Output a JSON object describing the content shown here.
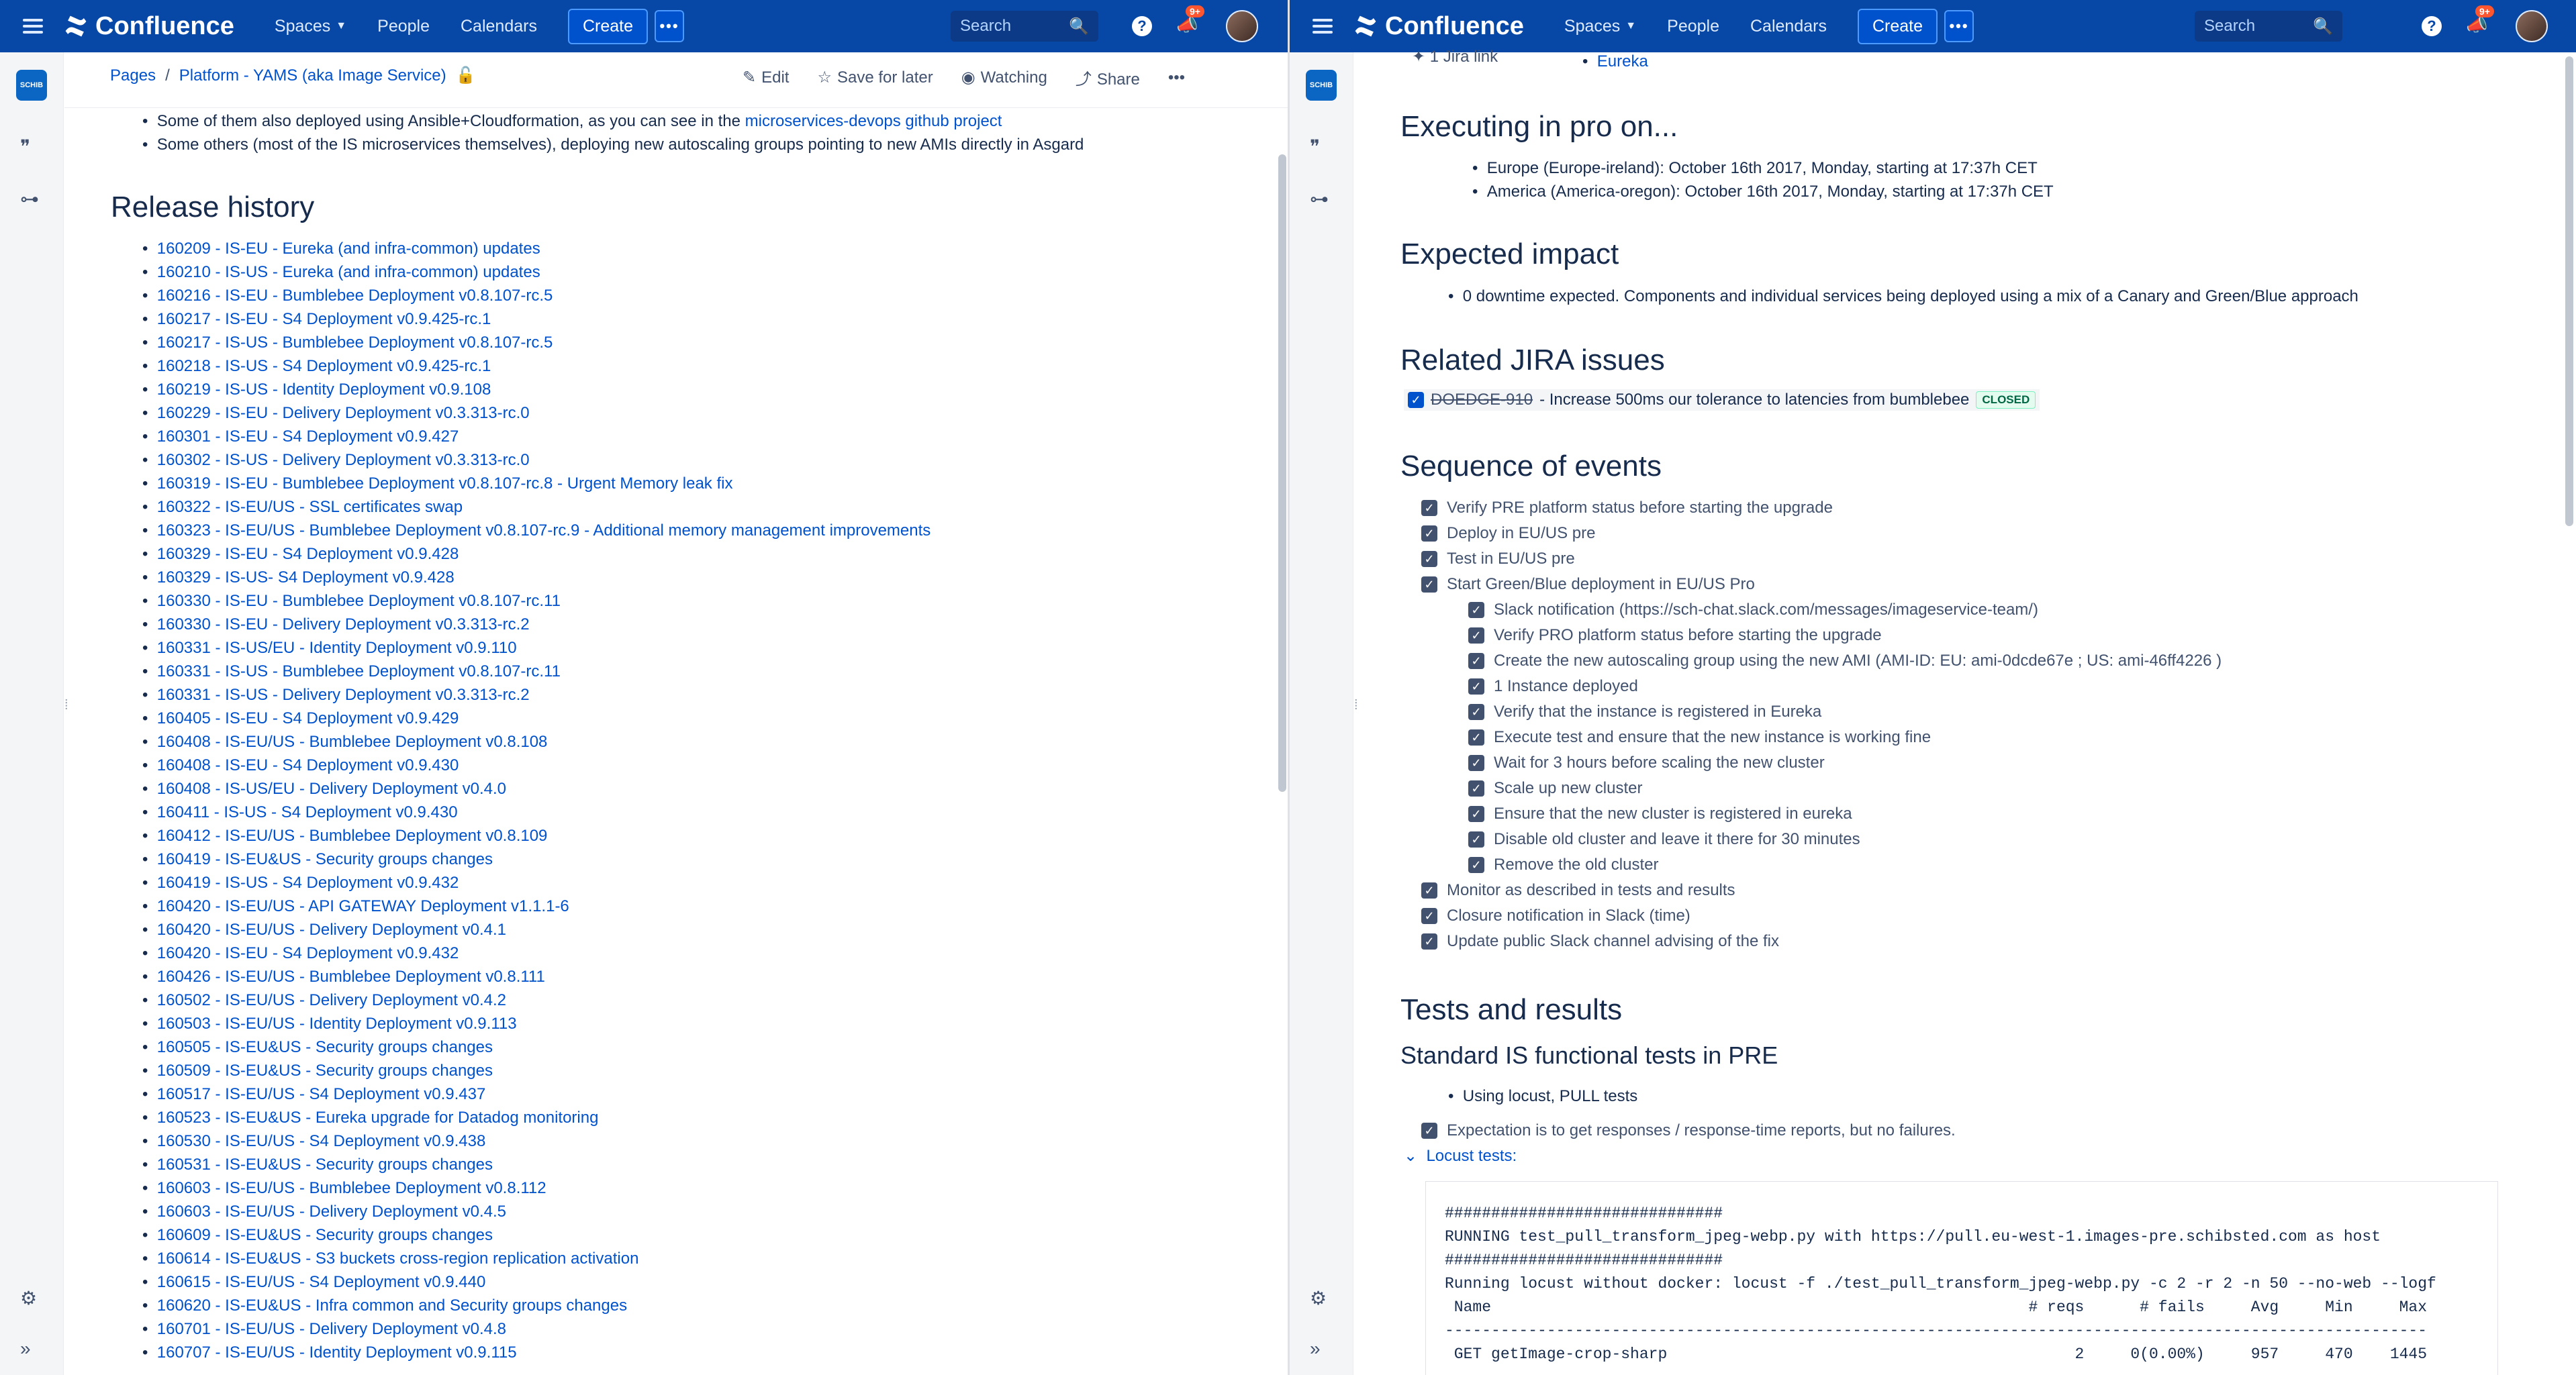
{
  "header": {
    "app_name": "Confluence",
    "nav": [
      "Spaces",
      "People",
      "Calendars"
    ],
    "create_label": "Create",
    "more_label": "•••",
    "search_placeholder": "Search",
    "notifications_badge": "9+",
    "help_label": "?"
  },
  "left": {
    "breadcrumb": [
      "Pages",
      "Platform - YAMS (aka Image Service)"
    ],
    "actions": {
      "edit": "Edit",
      "save_for_later": "Save for later",
      "watching": "Watching",
      "share": "Share",
      "more": "•••"
    },
    "intro_bullets": [
      {
        "text": "Some of them also deployed using Ansible+Cloudformation, as you can see in the ",
        "link": "microservices-devops github project"
      },
      {
        "text": "Some others (most of the IS microservices themselves), deploying new autoscaling groups pointing to new AMIs directly in Asgard",
        "link": ""
      }
    ],
    "release_heading": "Release history",
    "releases": [
      "160209 - IS-EU - Eureka (and infra-common) updates",
      "160210 - IS-US - Eureka (and infra-common) updates",
      "160216 - IS-EU - Bumblebee Deployment v0.8.107-rc.5",
      "160217 - IS-EU - S4 Deployment v0.9.425-rc.1",
      "160217 - IS-US - Bumblebee Deployment v0.8.107-rc.5",
      "160218 - IS-US - S4 Deployment v0.9.425-rc.1",
      "160219 - IS-US - Identity Deployment v0.9.108",
      "160229 - IS-EU - Delivery Deployment v0.3.313-rc.0",
      "160301 - IS-EU - S4 Deployment v0.9.427",
      "160302 - IS-US - Delivery Deployment v0.3.313-rc.0",
      "160319 - IS-EU - Bumblebee Deployment v0.8.107-rc.8 - Urgent Memory leak fix",
      "160322 - IS-EU/US - SSL certificates swap",
      "160323 - IS-EU/US - Bumblebee Deployment v0.8.107-rc.9 - Additional memory management improvements",
      "160329 - IS-EU - S4 Deployment v0.9.428",
      "160329 - IS-US- S4 Deployment v0.9.428",
      "160330 - IS-EU - Bumblebee Deployment v0.8.107-rc.11",
      "160330 - IS-EU - Delivery Deployment v0.3.313-rc.2",
      "160331 - IS-US/EU - Identity Deployment v0.9.110",
      "160331 - IS-US - Bumblebee Deployment v0.8.107-rc.11",
      "160331 - IS-US - Delivery Deployment v0.3.313-rc.2",
      "160405 - IS-EU - S4 Deployment v0.9.429",
      "160408 - IS-EU/US - Bumblebee Deployment v0.8.108",
      "160408 - IS-EU - S4 Deployment v0.9.430",
      "160408 - IS-US/EU - Delivery Deployment v0.4.0",
      "160411 - IS-US - S4 Deployment v0.9.430",
      "160412 - IS-EU/US - Bumblebee Deployment v0.8.109",
      "160419 - IS-EU&US - Security groups changes",
      "160419 - IS-US - S4 Deployment v0.9.432",
      "160420 - IS-EU/US - API GATEWAY Deployment v1.1.1-6",
      "160420 - IS-EU/US - Delivery Deployment v0.4.1",
      "160420 - IS-EU - S4 Deployment v0.9.432",
      "160426 - IS-EU/US - Bumblebee Deployment v0.8.111",
      "160502 - IS-EU/US - Delivery Deployment v0.4.2",
      "160503 - IS-EU/US - Identity Deployment v0.9.113",
      "160505 - IS-EU&US - Security groups changes",
      "160509 - IS-EU&US - Security groups changes",
      "160517 - IS-EU/US - S4 Deployment v0.9.437",
      "160523 - IS-EU&US - Eureka upgrade for Datadog monitoring",
      "160530 - IS-EU/US - S4 Deployment v0.9.438",
      "160531 - IS-EU&US - Security groups changes",
      "160603 - IS-EU/US - Bumblebee Deployment v0.8.112",
      "160603 - IS-EU/US - Delivery Deployment v0.4.5",
      "160609 - IS-EU&US - Security groups changes",
      "160614 - IS-EU&US - S3 buckets cross-region replication activation",
      "160615 - IS-EU/US - S4 Deployment v0.9.440",
      "160620 - IS-EU&US - Infra common and Security groups changes",
      "160701 - IS-EU/US - Delivery Deployment v0.4.8",
      "160707 - IS-EU/US - Identity Deployment v0.9.115"
    ]
  },
  "right": {
    "jira_link_label": "1 Jira link",
    "eureka_link": "Eureka",
    "executing_heading": "Executing in pro on...",
    "executing_items": [
      "Europe (Europe-ireland): October 16th 2017, Monday, starting at 17:37h CET",
      "America (America-oregon): October 16th 2017, Monday, starting at 17:37h CET"
    ],
    "impact_heading": "Expected impact",
    "impact_items": [
      "0 downtime expected. Components and individual services being deployed using a mix of a Canary and Green/Blue approach"
    ],
    "jira_heading": "Related JIRA issues",
    "jira_issue": {
      "key": "DOEDGE-910",
      "summary": " - Increase 500ms our tolerance to latencies from bumblebee",
      "status": "CLOSED"
    },
    "sequence_heading": "Sequence of events",
    "tasks": [
      {
        "text": "Verify PRE platform status before starting the upgrade",
        "level": 0
      },
      {
        "text": "Deploy in EU/US pre",
        "level": 0
      },
      {
        "text": "Test in EU/US pre",
        "level": 0
      },
      {
        "text": "Start Green/Blue deployment in EU/US Pro",
        "level": 0
      },
      {
        "text": "Slack notification (https://sch-chat.slack.com/messages/imageservice-team/)",
        "level": 1
      },
      {
        "text": "Verify PRO platform status before starting the upgrade",
        "level": 1
      },
      {
        "text": "Create the new autoscaling group using the new AMI (AMI-ID: EU: ami-0dcde67e ; US: ami-46ff4226 )",
        "level": 1
      },
      {
        "text": "1 Instance deployed",
        "level": 1
      },
      {
        "text": "Verify that the instance is registered in Eureka",
        "level": 1
      },
      {
        "text": "Execute test and ensure that the new instance is working fine",
        "level": 1
      },
      {
        "text": "Wait for 3 hours before scaling the new cluster",
        "level": 1
      },
      {
        "text": "Scale up new cluster",
        "level": 1
      },
      {
        "text": "Ensure that the new cluster is registered in eureka",
        "level": 1
      },
      {
        "text": "Disable old cluster and leave it there for 30 minutes",
        "level": 1
      },
      {
        "text": "Remove the old cluster",
        "level": 1
      },
      {
        "text": "Monitor as described in tests and results",
        "level": 0
      },
      {
        "text": "Closure notification in Slack (time)",
        "level": 0
      },
      {
        "text": "Update public Slack channel advising of the fix",
        "level": 0
      }
    ],
    "tests_heading": "Tests and results",
    "functional_heading": "Standard IS functional tests in PRE",
    "functional_bullet": "Using locust, PULL tests",
    "expectation_task": "Expectation is to get responses / response-time reports, but no failures.",
    "expand_label": "Locust tests:",
    "code_lines": [
      "##############################",
      "RUNNING test_pull_transform_jpeg-webp.py with https://pull.eu-west-1.images-pre.schibsted.com as host",
      "##############################",
      "Running locust without docker: locust -f ./test_pull_transform_jpeg-webp.py -c 2 -r 2 -n 50 --no-web --logf",
      " Name                                                          # reqs      # fails     Avg     Min     Max",
      "----------------------------------------------------------------------------------------------------------",
      " GET getImage-crop-sharp                                            2     0(0.00%)     957     470    1445"
    ]
  }
}
